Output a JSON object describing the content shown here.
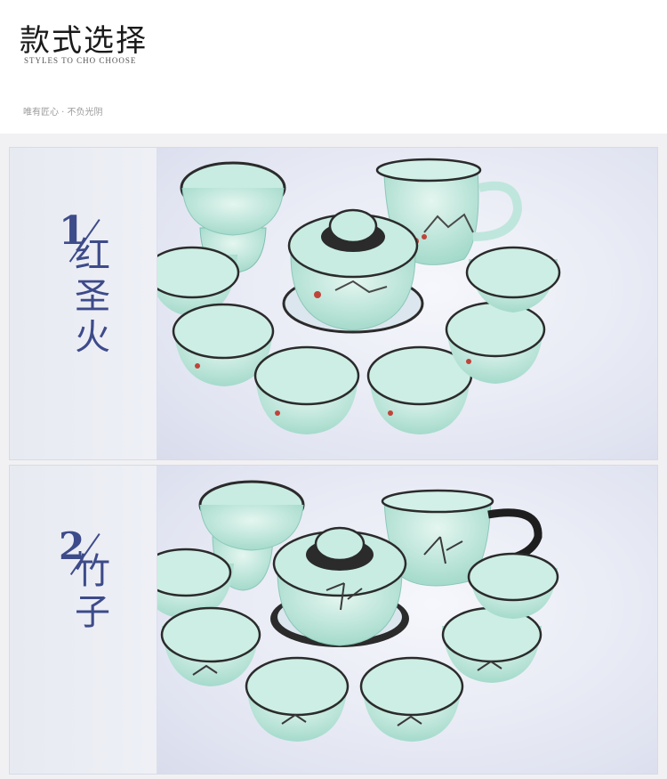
{
  "header": {
    "title": "款式选择",
    "subtitle": "STYLES TO CHO CHOOSE",
    "slogan": "唯有匠心 · 不负光阴"
  },
  "styles": [
    {
      "number": "1",
      "name_chars": [
        "红",
        "圣",
        "火"
      ]
    },
    {
      "number": "2",
      "name_chars": [
        "竹",
        "子"
      ]
    }
  ],
  "colors": {
    "accent": "#3d4b8a",
    "celadon": "#bfe6dc",
    "rim": "#2b2b2b"
  }
}
